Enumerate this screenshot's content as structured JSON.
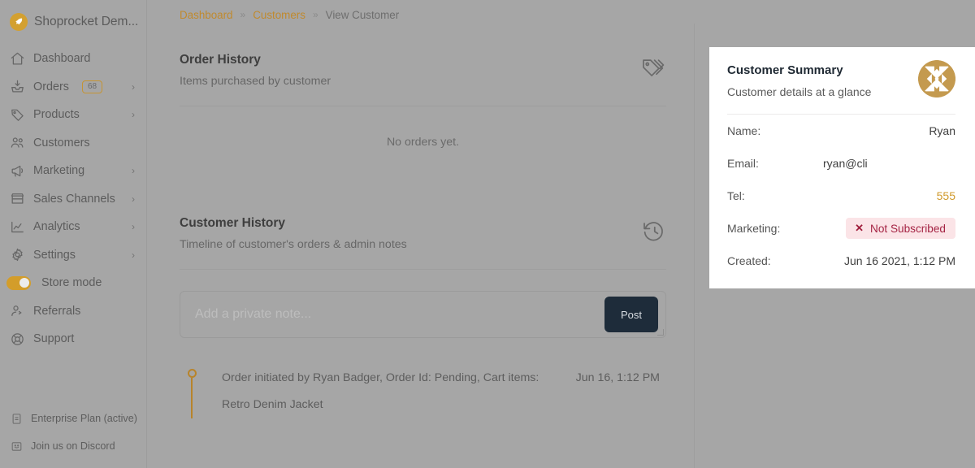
{
  "brand": {
    "name": "Shoprocket Dem...",
    "logo_icon": "rocket-icon",
    "accent_color": "#d3a030"
  },
  "sidebar": {
    "items": [
      {
        "label": "Dashboard",
        "icon": "home-icon",
        "badge": null,
        "chevron": false,
        "toggle": false
      },
      {
        "label": "Orders",
        "icon": "inbox-icon",
        "badge": "68",
        "chevron": true,
        "toggle": false
      },
      {
        "label": "Products",
        "icon": "tag-icon",
        "badge": null,
        "chevron": true,
        "toggle": false
      },
      {
        "label": "Customers",
        "icon": "users-icon",
        "badge": null,
        "chevron": false,
        "toggle": false
      },
      {
        "label": "Marketing",
        "icon": "megaphone-icon",
        "badge": null,
        "chevron": true,
        "toggle": false
      },
      {
        "label": "Sales Channels",
        "icon": "storefront-icon",
        "badge": null,
        "chevron": true,
        "toggle": false
      },
      {
        "label": "Analytics",
        "icon": "chart-icon",
        "badge": null,
        "chevron": true,
        "toggle": false
      },
      {
        "label": "Settings",
        "icon": "gear-icon",
        "badge": null,
        "chevron": true,
        "toggle": false
      },
      {
        "label": "Store mode",
        "icon": "toggle-on-icon",
        "badge": null,
        "chevron": false,
        "toggle": true
      },
      {
        "label": "Referrals",
        "icon": "user-plus-icon",
        "badge": null,
        "chevron": false,
        "toggle": false
      },
      {
        "label": "Support",
        "icon": "lifebuoy-icon",
        "badge": null,
        "chevron": false,
        "toggle": false
      }
    ],
    "footer": [
      {
        "label": "Enterprise Plan (active)",
        "icon": "document-icon"
      },
      {
        "label": "Join us on Discord",
        "icon": "discord-icon"
      }
    ]
  },
  "breadcrumb": {
    "items": [
      {
        "label": "Dashboard",
        "current": false
      },
      {
        "label": "Customers",
        "current": false
      },
      {
        "label": "View Customer",
        "current": true
      }
    ],
    "separator": "»",
    "link_color": "#c08a2e"
  },
  "order_history": {
    "title": "Order History",
    "subtitle": "Items purchased by customer",
    "icon": "tags-icon",
    "empty_message": "No orders yet."
  },
  "customer_history": {
    "title": "Customer History",
    "subtitle": "Timeline of customer's orders & admin notes",
    "icon": "history-icon",
    "note_input": {
      "value": "",
      "placeholder": "Add a private note..."
    },
    "post_label": "Post",
    "timeline": [
      {
        "text": "Order initiated by Ryan Badger, Order Id: Pending, Cart items:",
        "text_line2": "Retro Denim Jacket",
        "time": "Jun 16, 1:12 PM"
      }
    ]
  },
  "customer_summary": {
    "title": "Customer Summary",
    "subtitle": "Customer details at a glance",
    "avatar_icon": "identicon-avatar",
    "avatar_color": "#c49a4f",
    "rows": [
      {
        "key": "Name:",
        "value": "Ryan",
        "style": "right"
      },
      {
        "key": "Email:",
        "value": "ryan@cli",
        "style": "left"
      },
      {
        "key": "Tel:",
        "value": "555",
        "style": "gold"
      },
      {
        "key": "Marketing:",
        "value": "Not Subscribed",
        "style": "badge"
      },
      {
        "key": "Created:",
        "value": "Jun 16 2021, 1:12 PM",
        "style": "right"
      }
    ],
    "badge_bg": "#fbe4e7",
    "badge_fg": "#a52444",
    "badge_icon": "x-mark-icon"
  }
}
